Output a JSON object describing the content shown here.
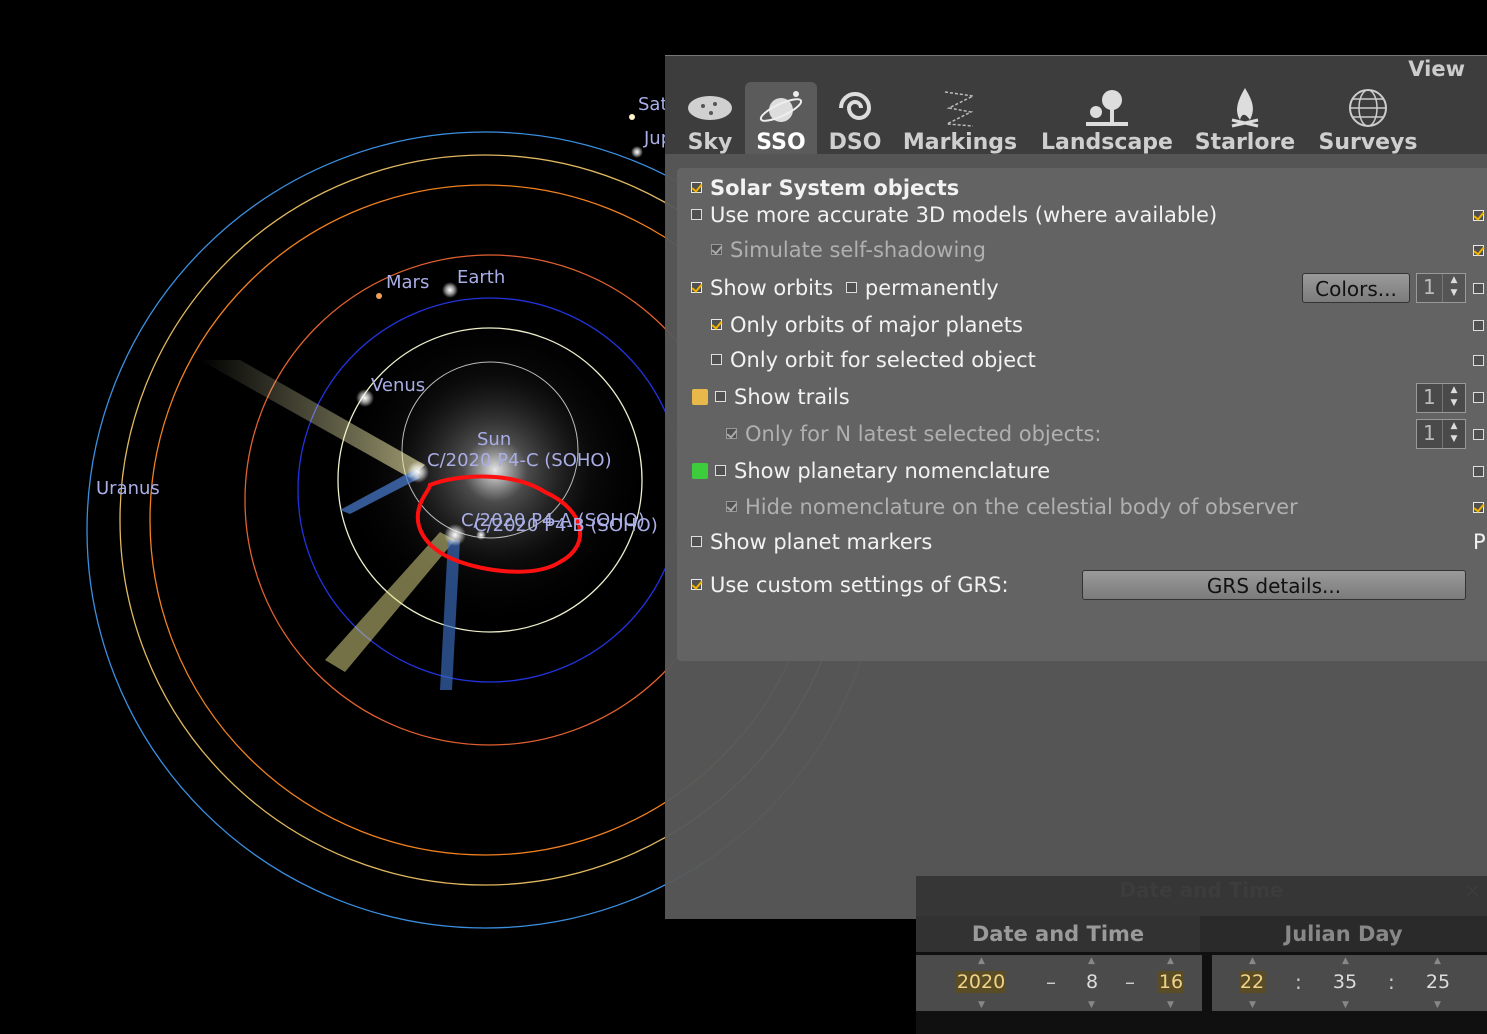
{
  "sky": {
    "planets": {
      "saturn": "Saturn",
      "jupiter": "Jupiter",
      "mars": "Mars",
      "earth": "Earth",
      "venus": "Venus",
      "uranus": "Uranus",
      "sun": "Sun"
    },
    "comet_main": "C/2020 P4-C (SOHO)",
    "comet_b": "C/2020 P4-A (SOHO)",
    "comet_c": "C/2020 P4-B (SOHO)"
  },
  "view_window": {
    "title": "View",
    "tabs": [
      {
        "label": "Sky",
        "icon": "sky-icon"
      },
      {
        "label": "SSO",
        "icon": "sso-icon",
        "active": true
      },
      {
        "label": "DSO",
        "icon": "dso-icon"
      },
      {
        "label": "Markings",
        "icon": "markings-icon"
      },
      {
        "label": "Landscape",
        "icon": "landscape-icon"
      },
      {
        "label": "Starlore",
        "icon": "starlore-icon"
      },
      {
        "label": "Surveys",
        "icon": "surveys-icon"
      }
    ],
    "sso": {
      "solar_system_objects": "Solar System objects",
      "accurate_models": "Use more accurate 3D models (where available)",
      "self_shadowing": "Simulate self-shadowing",
      "show_orbits": "Show orbits",
      "permanently": "permanently",
      "colors_button": "Colors...",
      "orbits_thickness": "1",
      "only_major": "Only orbits of major planets",
      "only_selected": "Only orbit for selected object",
      "show_trails": "Show trails",
      "trails_thickness": "1",
      "only_n_latest": "Only for N latest selected objects:",
      "n_latest_value": "1",
      "show_nomenclature": "Show planetary nomenclature",
      "hide_nomenclature": "Hide nomenclature on the celestial body of observer",
      "show_markers": "Show planet markers",
      "right_cut_text": "P",
      "use_grs": "Use custom settings of GRS:",
      "grs_button": "GRS details...",
      "trails_color": "#e8b84a",
      "nomenclature_color": "#3ccc3c"
    }
  },
  "datetime_window": {
    "title": "Date and Time",
    "close": "×",
    "date_header": "Date and Time",
    "jd_header": "Julian Day",
    "year": "2020",
    "month": "8",
    "day": "16",
    "hour": "22",
    "minute": "35",
    "second": "25",
    "date_sep": "–",
    "time_sep": ":"
  }
}
